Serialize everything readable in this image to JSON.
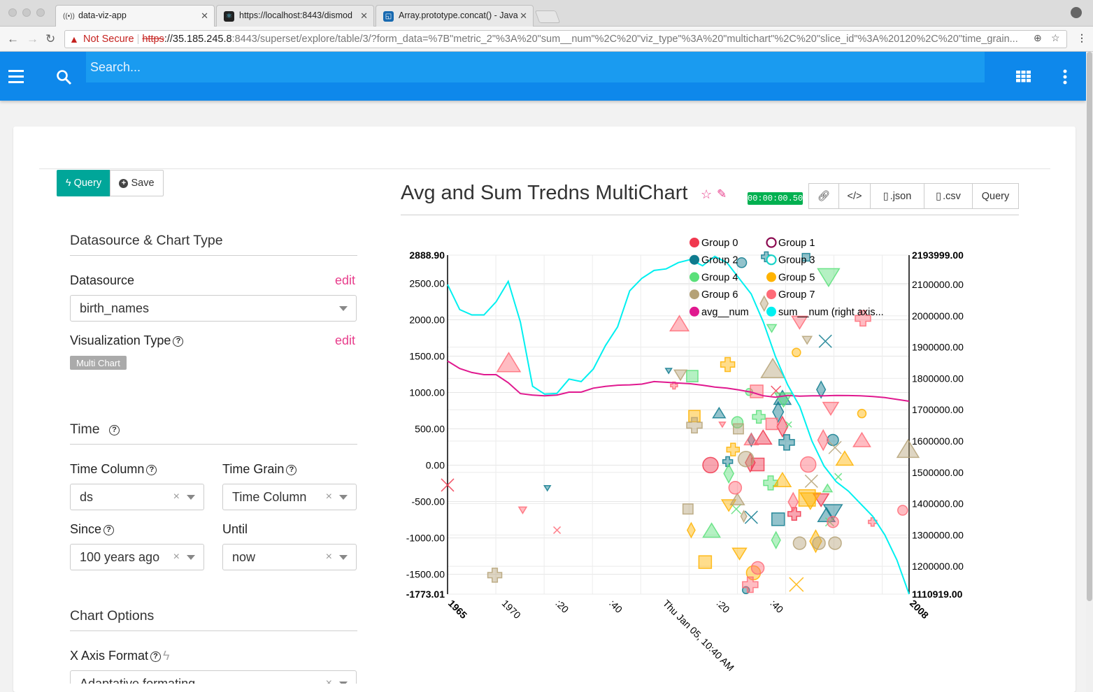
{
  "browser": {
    "tabs": [
      {
        "title": "data-viz-app",
        "icon": "radio-icon"
      },
      {
        "title": "https://localhost:8443/dismod",
        "icon": "react-icon"
      },
      {
        "title": "Array.prototype.concat() - Java",
        "icon": "mdn-icon"
      }
    ],
    "url": {
      "security": "Not Secure",
      "scheme": "https",
      "host": "://35.185.245.8",
      "path": ":8443/superset/explore/table/3/?form_data=%7B\"metric_2\"%3A%20\"sum__num\"%2C%20\"viz_type\"%3A%20\"multichart\"%2C%20\"slice_id\"%3A%20120%2C%20\"time_grain..."
    }
  },
  "appbar": {
    "search_placeholder": "Search...",
    "icons": [
      "menu-icon",
      "search-icon",
      "apps-grid-icon",
      "more-vert-icon"
    ]
  },
  "actions": {
    "query_label": "Query",
    "save_label": "Save"
  },
  "sidebar": {
    "datasource_section": "Datasource & Chart Type",
    "datasource_label": "Datasource",
    "datasource_edit": "edit",
    "datasource_value": "birth_names",
    "viz_type_label": "Visualization Type",
    "viz_type_edit": "edit",
    "viz_type_value": "Multi Chart",
    "time_section": "Time",
    "time_column_label": "Time Column",
    "time_column_value": "ds",
    "time_grain_label": "Time Grain",
    "time_grain_value": "Time Column",
    "since_label": "Since",
    "since_value": "100 years ago",
    "until_label": "Until",
    "until_value": "now",
    "chart_options_section": "Chart Options",
    "x_axis_format_label": "X Axis Format",
    "x_axis_format_value": "Adaptative formating"
  },
  "chart_header": {
    "title": "Avg and Sum Tredns MultiChart",
    "timer": "00:00:00.50",
    "tools": {
      "json": ".json",
      "csv": ".csv",
      "query": "Query"
    }
  },
  "chart_data": {
    "type": "line",
    "title": "Avg and Sum Tredns MultiChart",
    "x_ticks": [
      "1965",
      "1970",
      ":20",
      ":40",
      "Thu Jan 05, 10:40 AM",
      ":20",
      ":40",
      "2008"
    ],
    "y_left": {
      "min": -1773.01,
      "max": 2888.9,
      "ticks": [
        "2888.90",
        "2500.00",
        "2000.00",
        "1500.00",
        "1000.00",
        "500.00",
        "0.00",
        "-500.00",
        "-1000.00",
        "-1500.00",
        "-1773.01"
      ]
    },
    "y_right": {
      "min": 1110919.0,
      "max": 2193999.0,
      "ticks": [
        "2193999.00",
        "2100000.00",
        "2000000.00",
        "1900000.00",
        "1800000.00",
        "1700000.00",
        "1600000.00",
        "1500000.00",
        "1400000.00",
        "1300000.00",
        "1200000.00",
        "1110919.00"
      ]
    },
    "legend": [
      {
        "name": "Group 0",
        "color": "#f0384f",
        "hollow": false
      },
      {
        "name": "Group 1",
        "color": "#8b0a50",
        "hollow": true
      },
      {
        "name": "Group 2",
        "color": "#0f7b8e",
        "hollow": false
      },
      {
        "name": "Group 3",
        "color": "#1ad3c8",
        "hollow": true
      },
      {
        "name": "Group 4",
        "color": "#5ae07a",
        "hollow": false
      },
      {
        "name": "Group 5",
        "color": "#ffb300",
        "hollow": false
      },
      {
        "name": "Group 6",
        "color": "#b5a277",
        "hollow": false
      },
      {
        "name": "Group 7",
        "color": "#ff6b78",
        "hollow": false
      },
      {
        "name": "avg__num",
        "color": "#e0198f",
        "hollow": false
      },
      {
        "name": "sum__num (right axis...",
        "color": "#00f0f0",
        "hollow": false
      }
    ],
    "series": [
      {
        "name": "avg__num",
        "axis": "left",
        "color": "#e0198f",
        "values": [
          1433,
          1330,
          1275,
          1245,
          1245,
          1135,
          985,
          965,
          955,
          965,
          1005,
          1005,
          1060,
          1085,
          1100,
          1105,
          1115,
          1150,
          1140,
          1130,
          1120,
          1100,
          1075,
          1060,
          1035,
          1005,
          955,
          935,
          960,
          950,
          955,
          955,
          960,
          958,
          955,
          945,
          930,
          905,
          880
        ]
      },
      {
        "name": "sum__num",
        "axis": "right",
        "color": "#00f0f0",
        "values": [
          2100000,
          2020000,
          2003000,
          2003000,
          2045000,
          2110000,
          1980000,
          1775000,
          1750000,
          1752000,
          1798000,
          1790000,
          1830000,
          1905000,
          1965000,
          2080000,
          2120000,
          2145000,
          2150000,
          2170000,
          2180000,
          2160000,
          2190000,
          2170000,
          2120000,
          2070000,
          1980000,
          1870000,
          1780000,
          1710000,
          1600000,
          1520000,
          1470000,
          1440000,
          1400000,
          1360000,
          1300000,
          1220000,
          1110919
        ]
      }
    ],
    "scatter": [
      {
        "g": 0,
        "s": "circle",
        "x": 1989.5,
        "y": 1.5,
        "r": 11
      },
      {
        "g": 0,
        "s": "x",
        "x": 1965.0,
        "y": -273,
        "r": 9
      },
      {
        "g": 0,
        "s": "diamond",
        "x": 1993.2,
        "y": 35,
        "r": 10
      },
      {
        "g": 0,
        "s": "square",
        "x": 1993.9,
        "y": 10,
        "r": 10
      },
      {
        "g": 0,
        "s": "triangle-up",
        "x": 1994.4,
        "y": 375,
        "r": 11
      },
      {
        "g": 0,
        "s": "diamond",
        "x": 1996.2,
        "y": 530,
        "r": 11
      },
      {
        "g": 0,
        "s": "cross",
        "x": 1997.3,
        "y": -670,
        "r": 9
      },
      {
        "g": 0,
        "s": "triangle-down",
        "x": 1999.8,
        "y": -470,
        "r": 10
      },
      {
        "g": 0,
        "s": "x",
        "x": 1995.6,
        "y": 1023,
        "r": 7
      },
      {
        "g": 2,
        "s": "circle",
        "x": 1992.4,
        "y": 2785,
        "r": 7
      },
      {
        "g": 2,
        "s": "cross",
        "x": 1994.7,
        "y": 2866,
        "r": 7
      },
      {
        "g": 2,
        "s": "square",
        "x": 1998.4,
        "y": 2860,
        "r": 6
      },
      {
        "g": 2,
        "s": "triangle-up",
        "x": 1990.3,
        "y": 713,
        "r": 8
      },
      {
        "g": 2,
        "s": "diamond",
        "x": 1995.8,
        "y": 733,
        "r": 11
      },
      {
        "g": 2,
        "s": "triangle-up",
        "x": 1996.2,
        "y": 921,
        "r": 11
      },
      {
        "g": 2,
        "s": "cross",
        "x": 1996.6,
        "y": 314,
        "r": 11
      },
      {
        "g": 2,
        "s": "diamond",
        "x": 1993.3,
        "y": 350,
        "r": 7
      },
      {
        "g": 2,
        "s": "circle",
        "x": 2000.9,
        "y": 347,
        "r": 8
      },
      {
        "g": 2,
        "s": "x",
        "x": 2000.2,
        "y": 1705,
        "r": 9
      },
      {
        "g": 2,
        "s": "x",
        "x": 1993.3,
        "y": -716,
        "r": 9
      },
      {
        "g": 2,
        "s": "triangle-down",
        "x": 2000.9,
        "y": -635,
        "r": 12
      },
      {
        "g": 2,
        "s": "triangle-up",
        "x": 2000.3,
        "y": -691,
        "r": 11
      },
      {
        "g": 2,
        "s": "square",
        "x": 1995.8,
        "y": -743,
        "r": 10
      },
      {
        "g": 2,
        "s": "circle",
        "x": 1992.8,
        "y": -1718,
        "r": 5
      },
      {
        "g": 2,
        "s": "triangle-down",
        "x": 1974.3,
        "y": -312,
        "r": 4
      },
      {
        "g": 2,
        "s": "triangle-down",
        "x": 1985.6,
        "y": 1301,
        "r": 4
      },
      {
        "g": 2,
        "s": "cross",
        "x": 1991.1,
        "y": 50,
        "r": 7
      },
      {
        "g": 2,
        "s": "diamond",
        "x": 1999.8,
        "y": 1040,
        "r": 9
      },
      {
        "g": 4,
        "s": "square",
        "x": 1987.8,
        "y": 1225,
        "r": 9
      },
      {
        "g": 4,
        "s": "circle",
        "x": 1992.0,
        "y": 590,
        "r": 8
      },
      {
        "g": 4,
        "s": "cross",
        "x": 1994.0,
        "y": 665,
        "r": 9
      },
      {
        "g": 4,
        "s": "triangle-up",
        "x": 1989.6,
        "y": -905,
        "r": 11
      },
      {
        "g": 4,
        "s": "diamond",
        "x": 1991.2,
        "y": -115,
        "r": 10
      },
      {
        "g": 4,
        "s": "x",
        "x": 1991.9,
        "y": -603,
        "r": 7
      },
      {
        "g": 4,
        "s": "diamond",
        "x": 1995.6,
        "y": -1030,
        "r": 9
      },
      {
        "g": 4,
        "s": "cross",
        "x": 1995.1,
        "y": -243,
        "r": 10
      },
      {
        "g": 4,
        "s": "triangle-down",
        "x": 2000.5,
        "y": 2595,
        "r": 14
      },
      {
        "g": 4,
        "s": "triangle-down",
        "x": 1995.2,
        "y": 1887,
        "r": 6
      },
      {
        "g": 4,
        "s": "triangle-down",
        "x": 1996.3,
        "y": 908,
        "r": 11
      },
      {
        "g": 4,
        "s": "triangle-up",
        "x": 2000.4,
        "y": -320,
        "r": 6
      },
      {
        "g": 4,
        "s": "x",
        "x": 2000.6,
        "y": -780,
        "r": 6
      },
      {
        "g": 4,
        "s": "x",
        "x": 1996.8,
        "y": 560,
        "r": 4
      },
      {
        "g": 4,
        "s": "circle",
        "x": 1993.1,
        "y": 1007,
        "r": 5
      },
      {
        "g": 4,
        "s": "x",
        "x": 2001.4,
        "y": -160,
        "r": 5
      },
      {
        "g": 5,
        "s": "cross",
        "x": 1991.1,
        "y": 1385,
        "r": 10
      },
      {
        "g": 5,
        "s": "square",
        "x": 1988.0,
        "y": 675,
        "r": 9
      },
      {
        "g": 5,
        "s": "circle",
        "x": 1997.5,
        "y": 1550,
        "r": 6
      },
      {
        "g": 5,
        "s": "triangle-up",
        "x": 1996.2,
        "y": -210,
        "r": 11
      },
      {
        "g": 5,
        "s": "square",
        "x": 1998.5,
        "y": -450,
        "r": 13
      },
      {
        "g": 5,
        "s": "triangle-down",
        "x": 1998.8,
        "y": -480,
        "r": 13
      },
      {
        "g": 5,
        "s": "diamond",
        "x": 1999.3,
        "y": -1045,
        "r": 12
      },
      {
        "g": 5,
        "s": "triangle-up",
        "x": 2002.0,
        "y": 85,
        "r": 11
      },
      {
        "g": 5,
        "s": "circle",
        "x": 2003.6,
        "y": 710,
        "r": 6
      },
      {
        "g": 5,
        "s": "cross",
        "x": 1991.6,
        "y": 215,
        "r": 9
      },
      {
        "g": 5,
        "s": "triangle-down",
        "x": 1991.2,
        "y": -545,
        "r": 9
      },
      {
        "g": 5,
        "s": "diamond",
        "x": 1987.7,
        "y": -893,
        "r": 8
      },
      {
        "g": 5,
        "s": "square",
        "x": 1989.0,
        "y": -1332,
        "r": 10
      },
      {
        "g": 5,
        "s": "triangle-down",
        "x": 1992.2,
        "y": -1210,
        "r": 9
      },
      {
        "g": 5,
        "s": "circle",
        "x": 1993.5,
        "y": -1480,
        "r": 10
      },
      {
        "g": 5,
        "s": "x",
        "x": 1997.5,
        "y": -1640,
        "r": 10
      },
      {
        "g": 6,
        "s": "cross",
        "x": 1969.4,
        "y": -1512,
        "r": 10
      },
      {
        "g": 6,
        "s": "square",
        "x": 1987.4,
        "y": -602,
        "r": 8
      },
      {
        "g": 6,
        "s": "cross",
        "x": 1988.0,
        "y": 550,
        "r": 11
      },
      {
        "g": 6,
        "s": "circle",
        "x": 1992.8,
        "y": 85,
        "r": 11
      },
      {
        "g": 6,
        "s": "triangle-up",
        "x": 1995.3,
        "y": 1320,
        "r": 15
      },
      {
        "g": 6,
        "s": "x",
        "x": 1998.9,
        "y": -220,
        "r": 9
      },
      {
        "g": 6,
        "s": "circle",
        "x": 1997.8,
        "y": -1072,
        "r": 9
      },
      {
        "g": 6,
        "s": "circle",
        "x": 1999.6,
        "y": -1072,
        "r": 9
      },
      {
        "g": 6,
        "s": "circle",
        "x": 2001.1,
        "y": -1072,
        "r": 9
      },
      {
        "g": 6,
        "s": "triangle-up",
        "x": 2007.9,
        "y": 215,
        "r": 14
      },
      {
        "g": 6,
        "s": "square",
        "x": 1992.1,
        "y": 500,
        "r": 8
      },
      {
        "g": 6,
        "s": "diamond",
        "x": 1992.6,
        "y": -703,
        "r": 6
      },
      {
        "g": 6,
        "s": "triangle-up",
        "x": 1992.0,
        "y": -475,
        "r": 9
      },
      {
        "g": 6,
        "s": "triangle-down",
        "x": 1986.7,
        "y": 1247,
        "r": 8
      },
      {
        "g": 6,
        "s": "triangle-down",
        "x": 1998.5,
        "y": 1725,
        "r": 6
      },
      {
        "g": 6,
        "s": "diamond",
        "x": 1994.5,
        "y": 2223,
        "r": 8
      },
      {
        "g": 6,
        "s": "x",
        "x": 2001.1,
        "y": 243,
        "r": 9
      },
      {
        "g": 7,
        "s": "triangle-up",
        "x": 1986.6,
        "y": 1940,
        "r": 12
      },
      {
        "g": 7,
        "s": "triangle-up",
        "x": 1970.7,
        "y": 1402,
        "r": 15
      },
      {
        "g": 7,
        "s": "triangle-down",
        "x": 1972.0,
        "y": -614,
        "r": 5
      },
      {
        "g": 7,
        "s": "x",
        "x": 1975.2,
        "y": -893,
        "r": 5
      },
      {
        "g": 7,
        "s": "circle",
        "x": 1991.8,
        "y": -310,
        "r": 9
      },
      {
        "g": 7,
        "s": "square",
        "x": 1993.8,
        "y": 1015,
        "r": 10
      },
      {
        "g": 7,
        "s": "triangle-down",
        "x": 1997.8,
        "y": 1972,
        "r": 10
      },
      {
        "g": 7,
        "s": "cross",
        "x": 2003.7,
        "y": 2020,
        "r": 11
      },
      {
        "g": 7,
        "s": "circle",
        "x": 1998.6,
        "y": 10,
        "r": 11
      },
      {
        "g": 7,
        "s": "diamond",
        "x": 1997.2,
        "y": -505,
        "r": 10
      },
      {
        "g": 7,
        "s": "triangle-down",
        "x": 2000.7,
        "y": 788,
        "r": 10
      },
      {
        "g": 7,
        "s": "diamond",
        "x": 2000.0,
        "y": 345,
        "r": 11
      },
      {
        "g": 7,
        "s": "cross",
        "x": 1993.2,
        "y": -1643,
        "r": 11
      },
      {
        "g": 7,
        "s": "circle",
        "x": 2007.4,
        "y": -620,
        "r": 7
      },
      {
        "g": 7,
        "s": "cross",
        "x": 2004.6,
        "y": -780,
        "r": 6
      },
      {
        "g": 7,
        "s": "triangle-up",
        "x": 1993.3,
        "y": 350,
        "r": 9
      },
      {
        "g": 7,
        "s": "triangle-down",
        "x": 1990.6,
        "y": 562,
        "r": 4
      },
      {
        "g": 7,
        "s": "cross",
        "x": 1986.1,
        "y": 1096,
        "r": 5
      },
      {
        "g": 7,
        "s": "circle",
        "x": 2000.9,
        "y": -780,
        "r": 8
      },
      {
        "g": 7,
        "s": "triangle-up",
        "x": 2003.6,
        "y": 340,
        "r": 11
      },
      {
        "g": 7,
        "s": "square",
        "x": 1995.2,
        "y": 568,
        "r": 9
      },
      {
        "g": 7,
        "s": "circle",
        "x": 1993.9,
        "y": -1412,
        "r": 9
      }
    ]
  }
}
